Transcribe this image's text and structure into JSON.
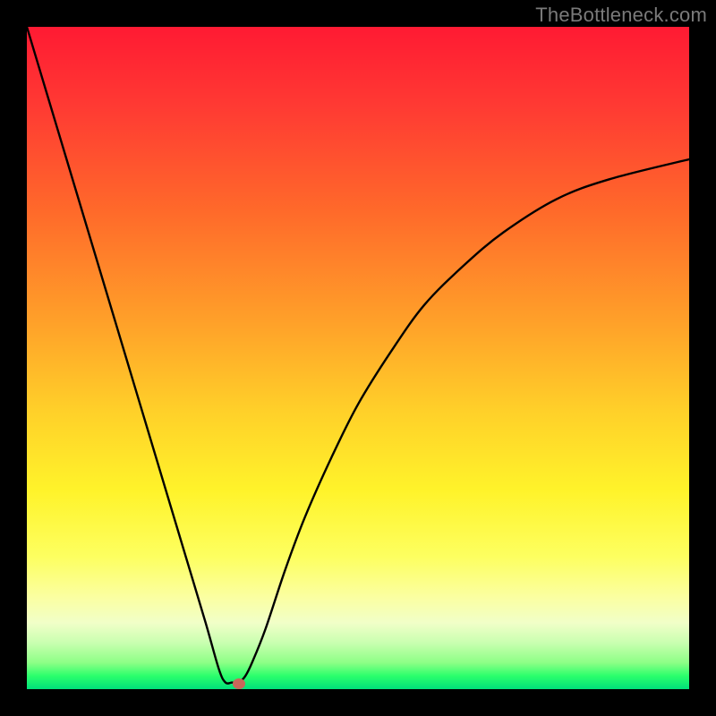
{
  "watermark": "TheBottleneck.com",
  "chart_data": {
    "type": "line",
    "title": "",
    "xlabel": "",
    "ylabel": "",
    "xlim": [
      0,
      100
    ],
    "ylim": [
      0,
      100
    ],
    "gradient_stops": [
      {
        "pos": 0,
        "color": "#ff1a33"
      },
      {
        "pos": 12,
        "color": "#ff3a33"
      },
      {
        "pos": 28,
        "color": "#ff6a2a"
      },
      {
        "pos": 45,
        "color": "#ffa229"
      },
      {
        "pos": 58,
        "color": "#ffd029"
      },
      {
        "pos": 70,
        "color": "#fff32a"
      },
      {
        "pos": 80,
        "color": "#fdff60"
      },
      {
        "pos": 86,
        "color": "#fbffa0"
      },
      {
        "pos": 90,
        "color": "#f1ffc8"
      },
      {
        "pos": 93,
        "color": "#c9ffb0"
      },
      {
        "pos": 96,
        "color": "#8dff86"
      },
      {
        "pos": 98,
        "color": "#2bff6c"
      },
      {
        "pos": 100,
        "color": "#00e07a"
      }
    ],
    "series": [
      {
        "name": "curve",
        "x": [
          0,
          3,
          6,
          9,
          12,
          15,
          18,
          21,
          24,
          27,
          29,
          30,
          31,
          32,
          33,
          34,
          36,
          39,
          42,
          46,
          50,
          55,
          60,
          66,
          72,
          80,
          88,
          100
        ],
        "y": [
          100,
          90,
          80,
          70,
          60,
          50,
          40,
          30,
          20,
          10,
          3,
          1,
          1,
          1,
          2,
          4,
          9,
          18,
          26,
          35,
          43,
          51,
          58,
          64,
          69,
          74,
          77,
          80
        ]
      }
    ],
    "marker": {
      "x": 32,
      "y": 0.8,
      "color": "#c9675a"
    }
  }
}
